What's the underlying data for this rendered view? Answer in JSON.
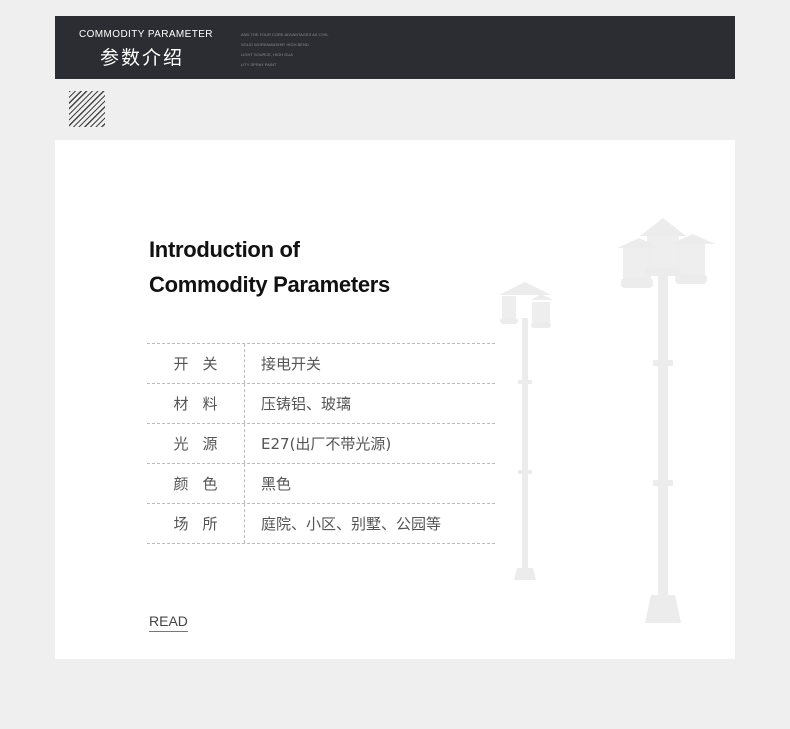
{
  "banner": {
    "title_en": "COMMODITY PARAMETER",
    "title_zh": "参数介绍",
    "tags": [
      "AND THE FOUR CORE ADVANTAGES AS CIVIL",
      "SOLID WORKMANSHIP, HIGH BEND",
      "LIGHT SOURCE, HIGH GUA",
      "LITY SPRAY PAINT"
    ]
  },
  "intro": {
    "line1": "Introduction of",
    "line2": "Commodity Parameters"
  },
  "params": [
    {
      "label": "开关",
      "value": "接电开关"
    },
    {
      "label": "材料",
      "value": "压铸铝、玻璃"
    },
    {
      "label": "光源",
      "value": "E27(出厂不带光源)"
    },
    {
      "label": "颜色",
      "value": "黑色"
    },
    {
      "label": "场所",
      "value": "庭院、小区、别墅、公园等"
    }
  ],
  "read_label": "READ",
  "colors": {
    "banner_bg": "#2b2d33",
    "page_bg": "#efefef",
    "card_bg": "#ffffff",
    "lamp_tint": "#ebebeb"
  }
}
